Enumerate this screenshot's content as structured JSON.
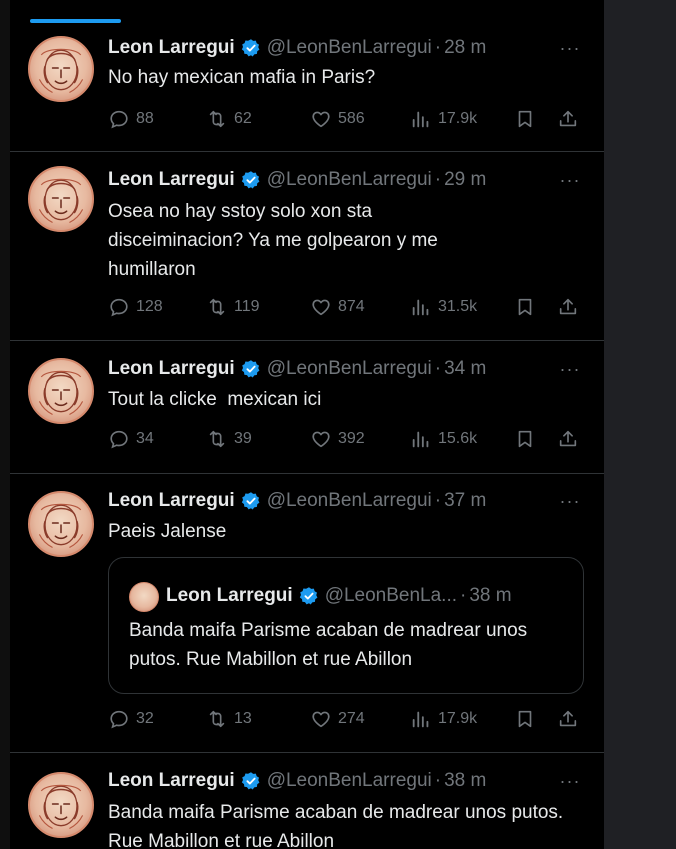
{
  "colors": {
    "accent": "#1d9bf0",
    "muted": "#71767b",
    "text": "#e7e9ea",
    "divider": "#2f3336",
    "background": "#000000"
  },
  "icons": [
    "reply-icon",
    "retweet-icon",
    "like-icon",
    "views-icon",
    "bookmark-icon",
    "share-icon",
    "verified-badge-icon",
    "more-icon"
  ],
  "tweets": [
    {
      "name": "Leon Larregui",
      "handle": "@LeonBenLarregui",
      "dot": "·",
      "time": "28 m",
      "text": "No hay mexican mafia in Paris?",
      "replies": "88",
      "retweets": "62",
      "likes": "586",
      "views": "17.9k"
    },
    {
      "name": "Leon Larregui",
      "handle": "@LeonBenLarregui",
      "dot": "·",
      "time": "29 m",
      "text": "Osea no hay sstoy solo xon sta disceiminacion? Ya me golpearon y me humillaron",
      "replies": "128",
      "retweets": "119",
      "likes": "874",
      "views": "31.5k"
    },
    {
      "name": "Leon Larregui",
      "handle": "@LeonBenLarregui",
      "dot": "·",
      "time": "34 m",
      "text": "Tout la clicke  mexican ici",
      "replies": "34",
      "retweets": "39",
      "likes": "392",
      "views": "15.6k"
    },
    {
      "name": "Leon Larregui",
      "handle": "@LeonBenLarregui",
      "dot": "·",
      "time": "37 m",
      "text": "Paeis Jalense",
      "quote": {
        "name": "Leon Larregui",
        "handle": "@LeonBenLa...",
        "dot": "·",
        "time": "38 m",
        "text": "Banda maifa Parisme acaban de madrear unos putos. Rue Mabillon et rue Abillon"
      },
      "replies": "32",
      "retweets": "13",
      "likes": "274",
      "views": "17.9k"
    },
    {
      "name": "Leon Larregui",
      "handle": "@LeonBenLarregui",
      "dot": "·",
      "time": "38 m",
      "text": "Banda maifa Parisme acaban de madrear unos putos. Rue Mabillon et rue Abillon"
    }
  ]
}
